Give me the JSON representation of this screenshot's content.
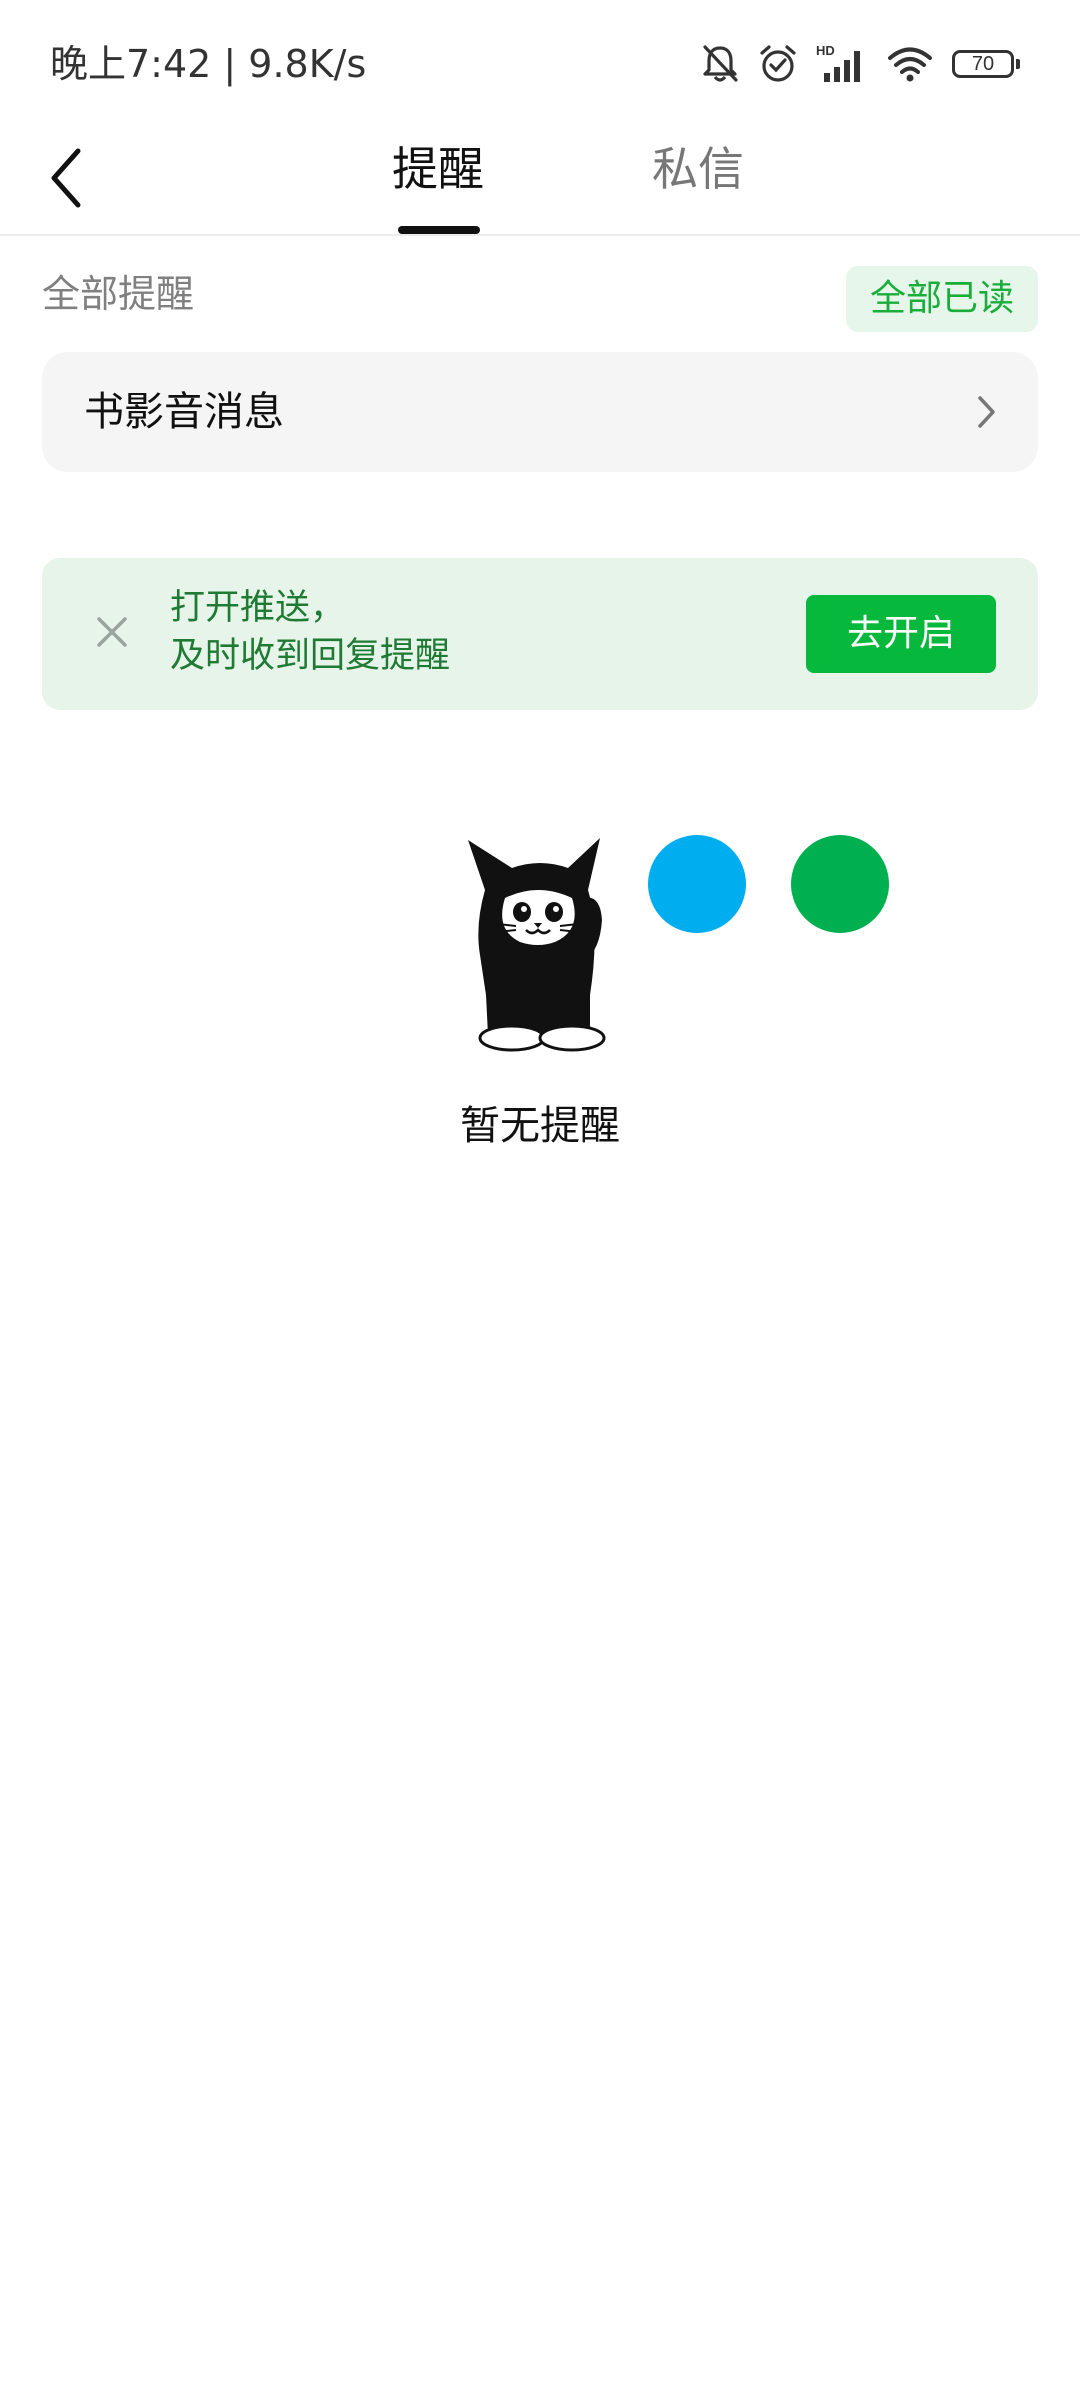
{
  "status_bar": {
    "time_text": "晚上7:42 | 9.8K/s",
    "battery_level": "70",
    "icons": [
      "bell-muted-icon",
      "alarm-icon",
      "hd-signal-icon",
      "wifi-icon",
      "battery-icon"
    ]
  },
  "nav": {
    "back_icon": "chevron-left-icon",
    "tabs": [
      {
        "label": "提醒",
        "active": true
      },
      {
        "label": "私信",
        "active": false
      }
    ]
  },
  "section": {
    "title": "全部提醒",
    "mark_all_read_label": "全部已读"
  },
  "category": {
    "label": "书影音消息",
    "icon": "chevron-right-icon"
  },
  "push_banner": {
    "line1": "打开推送，",
    "line2": "及时收到回复提醒",
    "button_label": "去开启",
    "close_icon": "close-icon"
  },
  "empty_state": {
    "illustration": "cat-mascot-icon",
    "text": "暂无提醒",
    "dot_colors": [
      "#00aef0",
      "#00b050"
    ]
  },
  "colors": {
    "accent_green": "#06b83b",
    "mark_read_text": "#1aad3a",
    "banner_bg": "#e7f4ea",
    "banner_text": "#1f7a34",
    "row_bg": "#f5f5f5"
  }
}
